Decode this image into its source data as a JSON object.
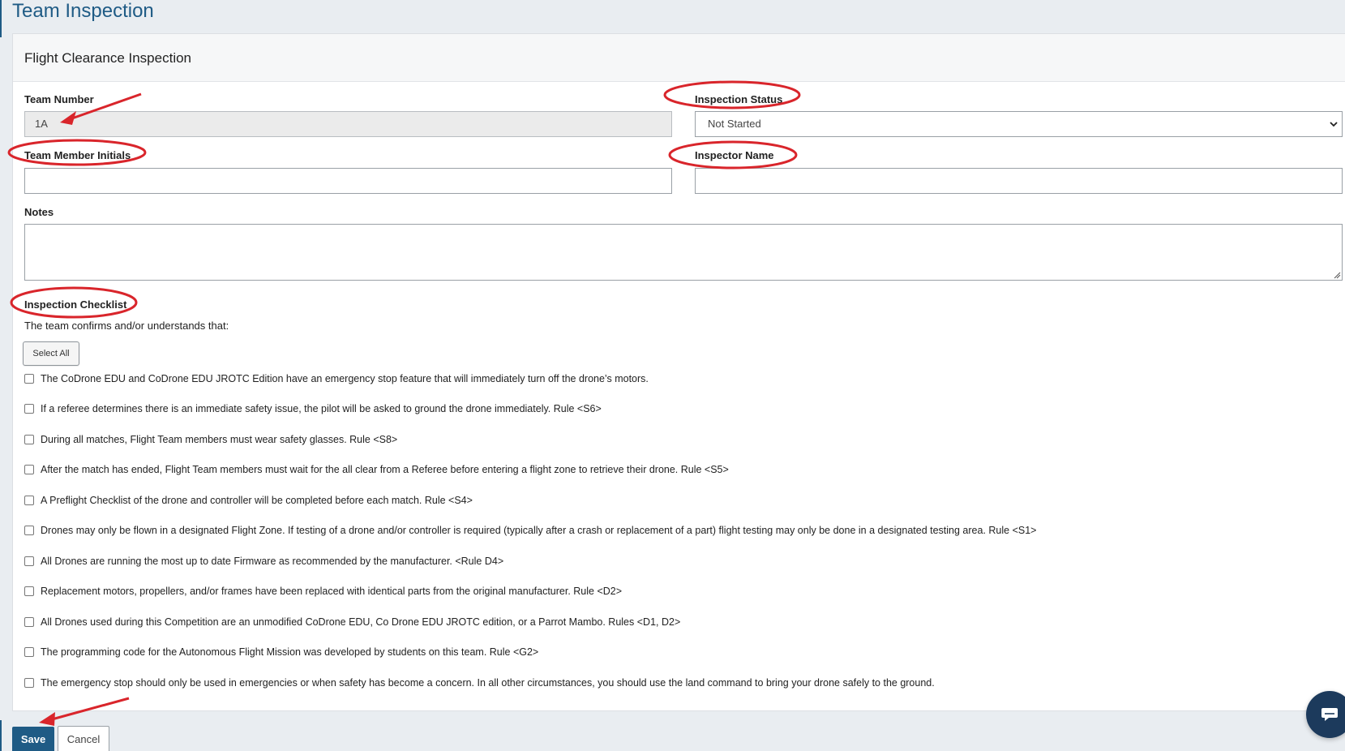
{
  "page": {
    "title": "Team Inspection"
  },
  "card": {
    "title": "Flight Clearance Inspection"
  },
  "form": {
    "team_number": {
      "label": "Team Number",
      "value": "1A"
    },
    "inspection_status": {
      "label": "Inspection Status",
      "value": "Not Started"
    },
    "team_member_initials": {
      "label": "Team Member Initials",
      "value": ""
    },
    "inspector_name": {
      "label": "Inspector Name",
      "value": ""
    },
    "notes": {
      "label": "Notes",
      "value": ""
    }
  },
  "checklist": {
    "title": "Inspection Checklist",
    "intro": "The team confirms and/or understands that:",
    "select_all_label": "Select All",
    "items": [
      "The CoDrone EDU and CoDrone EDU JROTC Edition have an emergency stop feature that will immediately turn off the drone’s motors.",
      "If a referee determines there is an immediate safety issue, the pilot will be asked to ground the drone immediately. Rule <S6>",
      "During all matches, Flight Team members must wear safety glasses. Rule <S8>",
      "After the match has ended, Flight Team members must wait for the all clear from a Referee before entering a flight zone to retrieve their drone. Rule <S5>",
      "A Preflight Checklist of the drone and controller will be completed before each match. Rule <S4>",
      "Drones may only be flown in a designated Flight Zone. If testing of a drone and/or controller is required (typically after a crash or replacement of a part) flight testing may only be done in a designated testing area. Rule <S1>",
      "All Drones are running the most up to date Firmware as recommended by the manufacturer. <Rule D4>",
      "Replacement motors, propellers, and/or frames have been replaced with identical parts from the original manufacturer. Rule <D2>",
      "All Drones used during this Competition are an unmodified CoDrone EDU, Co Drone EDU JROTC edition, or a Parrot Mambo. Rules <D1, D2>",
      "The programming code for the Autonomous Flight Mission was developed by students on this team. Rule <G2>",
      "The emergency stop should only be used in emergencies or when safety has become a concern. In all other circumstances, you should use the land command to bring your drone safely to the ground."
    ]
  },
  "actions": {
    "save_label": "Save",
    "cancel_label": "Cancel"
  },
  "icons": {
    "select_arrow": "chevron-down-icon",
    "chat": "chat-icon"
  },
  "colors": {
    "primary": "#1f5b85",
    "annotation": "#d9252b",
    "chat_button": "#1c3a5c"
  }
}
